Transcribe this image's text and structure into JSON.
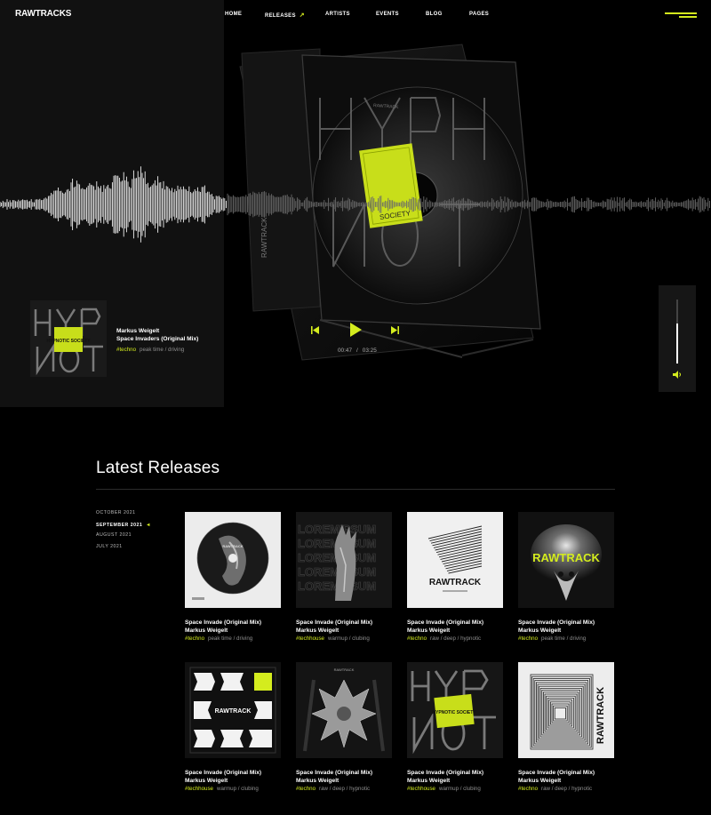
{
  "brand": {
    "logo": "RAWTRACKS",
    "accent": "#d4ec1e"
  },
  "nav": {
    "items": [
      {
        "label": "HOME"
      },
      {
        "label": "RELEASES",
        "arrow": "↗"
      },
      {
        "label": "ARTISTS"
      },
      {
        "label": "EVENTS"
      },
      {
        "label": "BLOG"
      },
      {
        "label": "PAGES"
      }
    ],
    "menu_icon": "hamburger-icon"
  },
  "hero": {
    "cd_art": {
      "label": "RAWTRACK",
      "wordmark": "HYPNOT",
      "sticker": "SOCIETY"
    },
    "player": {
      "artist": "Markus Weigelt",
      "title": "Space Invaders (Original Mix)",
      "tag": "#techno",
      "subtags": "peak time / driving",
      "current_time": "00:47",
      "separator": "/",
      "duration": "03:25",
      "volume": 0.62,
      "cover_sticker": "HYPNOTIC SOCIETY"
    }
  },
  "releases": {
    "heading": "Latest Releases",
    "months": [
      {
        "label": "OCTOBER 2021",
        "active": false
      },
      {
        "label": "SEPTEMBER 2021",
        "active": true,
        "marker": "◂"
      },
      {
        "label": "AUGUST 2021",
        "active": false
      },
      {
        "label": "JULY 2021",
        "active": false
      }
    ],
    "items": [
      {
        "title": "Space Invade (Original Mix)",
        "artist": "Markus Weigelt",
        "tag": "#techno",
        "subtags": "peak time / driving",
        "art": "disc-hands",
        "cover_text": "RAWTRACK"
      },
      {
        "title": "Space Invade (Original Mix)",
        "artist": "Markus Weigelt",
        "tag": "#techhouse",
        "subtags": "warmup / clubing",
        "art": "lorem-hand",
        "cover_text": "LOREMIPSUM"
      },
      {
        "title": "Space Invade (Original Mix)",
        "artist": "Markus Weigelt",
        "tag": "#techno",
        "subtags": "raw / deep / hypnotic",
        "art": "lines-white",
        "cover_text": "RAWTRACK"
      },
      {
        "title": "Space Invade (Original Mix)",
        "artist": "Markus Weigelt",
        "tag": "#techno",
        "subtags": "peak time / driving",
        "art": "skull-glow",
        "cover_text": "RAWTRACK"
      },
      {
        "title": "Space Invade (Original Mix)",
        "artist": "Markus Weigelt",
        "tag": "#techhouse",
        "subtags": "warmup / clubing",
        "art": "shapes-white",
        "cover_text": "RAWTRACK"
      },
      {
        "title": "Space Invade (Original Mix)",
        "artist": "Markus Weigelt",
        "tag": "#techno",
        "subtags": "raw / deep / hypnotic",
        "art": "symmetry",
        "cover_text": "RAWTRACK"
      },
      {
        "title": "Space Invade (Original Mix)",
        "artist": "Markus Weigelt",
        "tag": "#techhouse",
        "subtags": "warmup / clubing",
        "art": "hypnot",
        "cover_text": "HYPNOTIC SOCIETY"
      },
      {
        "title": "Space Invade (Original Mix)",
        "artist": "Markus Weigelt",
        "tag": "#techno",
        "subtags": "raw / deep / hypnotic",
        "art": "tunnel-white",
        "cover_text": "RAWTRACK"
      }
    ]
  }
}
